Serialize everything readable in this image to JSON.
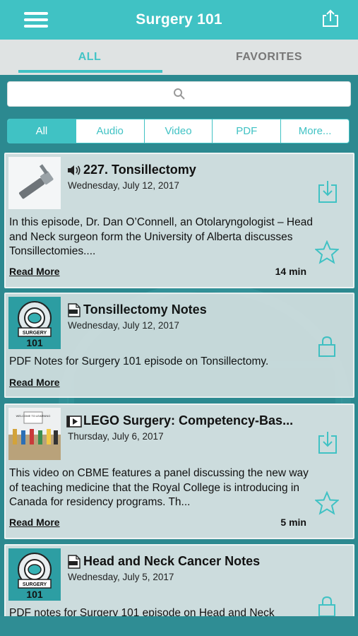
{
  "app": {
    "title": "Surgery 101"
  },
  "header": {
    "menu_icon": "hamburger-menu-icon",
    "share_icon": "share-icon"
  },
  "tabs": [
    {
      "label": "ALL",
      "selected": true
    },
    {
      "label": "FAVORITES",
      "selected": false
    }
  ],
  "search": {
    "placeholder": "",
    "icon": "search-icon"
  },
  "filters": [
    {
      "label": "All",
      "selected": true
    },
    {
      "label": "Audio",
      "selected": false
    },
    {
      "label": "Video",
      "selected": false
    },
    {
      "label": "PDF",
      "selected": false
    },
    {
      "label": "More...",
      "selected": false
    }
  ],
  "episodes": [
    {
      "type": "audio",
      "title": "227. Tonsillectomy",
      "date": "Wednesday, July 12, 2017",
      "description": "In this episode, Dr. Dan O’Connell, an Otolaryngologist – Head and Neck surgeon form the University of Alberta discusses Tonsillectomies....",
      "read_more": "Read More",
      "duration": "14 min"
    },
    {
      "type": "pdf",
      "title": "Tonsillectomy Notes",
      "date": "Wednesday, July 12, 2017",
      "description": "PDF Notes for Surgery 101 episode on Tonsillectomy.",
      "read_more": "Read More"
    },
    {
      "type": "video",
      "title": "LEGO Surgery: Competency-Bas...",
      "date": "Thursday, July 6, 2017",
      "description": "This video on CBME features a panel discussing the new way of teaching medicine that the Royal College is introducing in Canada for residency programs. Th...",
      "read_more": "Read More",
      "duration": "5 min"
    },
    {
      "type": "pdf",
      "title": "Head and Neck Cancer Notes",
      "date": "Wednesday, July 5, 2017",
      "description": "PDF notes for Surgery 101 episode on Head and Neck"
    }
  ],
  "logo_text": {
    "line1": "SURGERY",
    "line2": "101"
  },
  "video_thumb_text": "WELCOME TO LEARNING",
  "colors": {
    "accent": "#40c2c4",
    "card_bg": "#ccdcdd",
    "background": "#2c8990"
  }
}
